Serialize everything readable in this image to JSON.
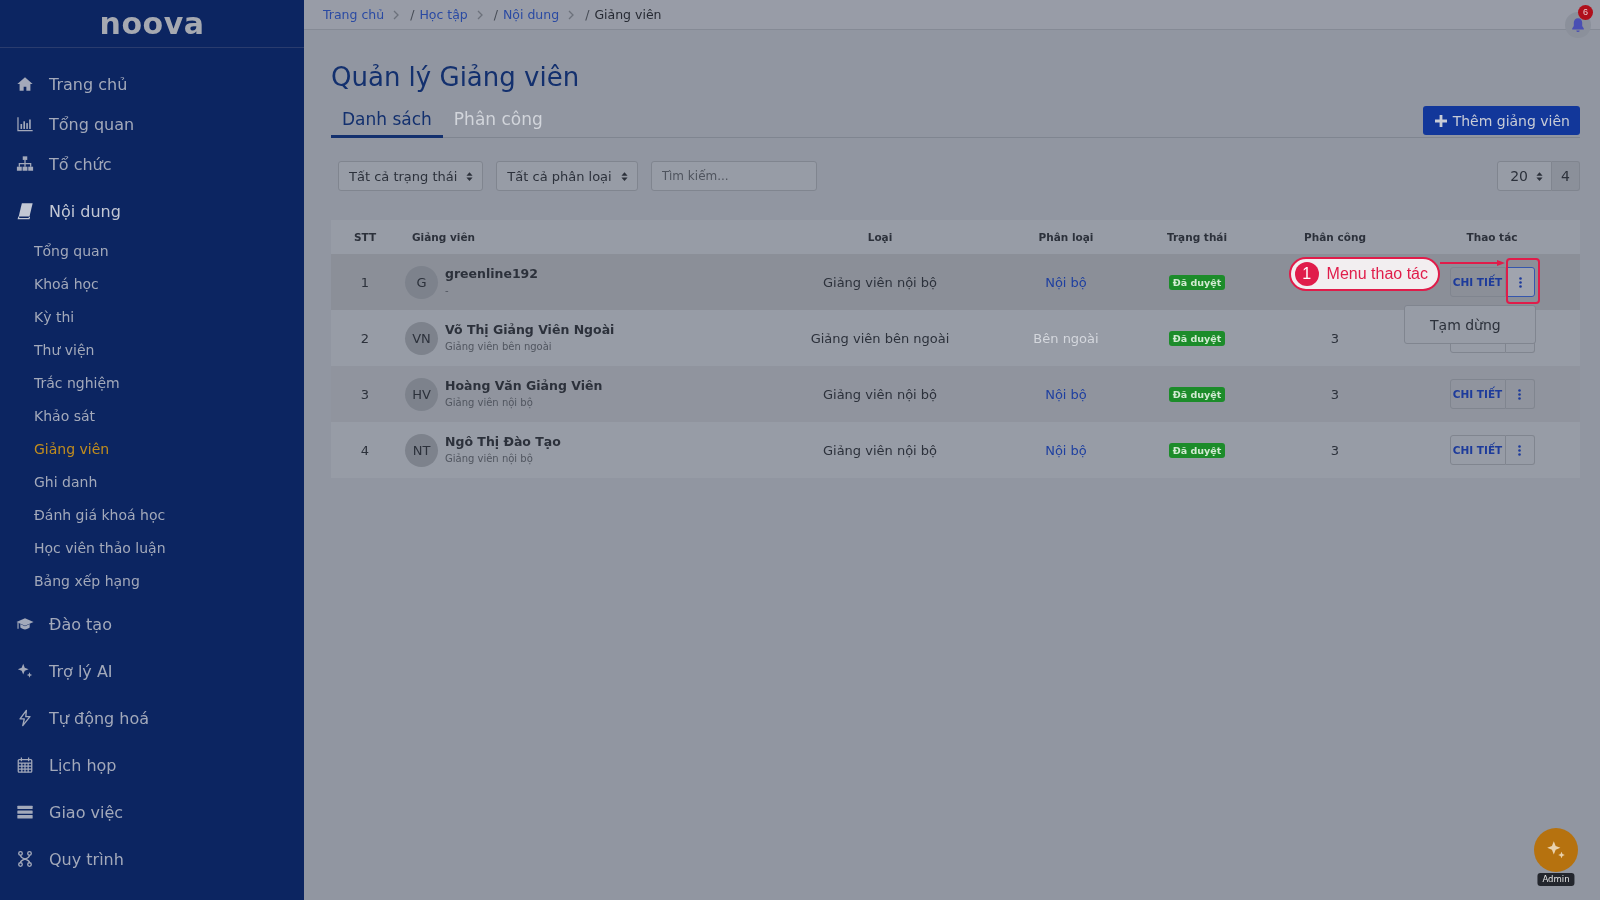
{
  "sidebar": {
    "logo": "noova",
    "items": [
      {
        "label": "Trang chủ",
        "selected": false,
        "expanded": false
      },
      {
        "label": "Tổng quan",
        "selected": false,
        "expanded": false
      },
      {
        "label": "Tổ chức",
        "selected": false,
        "expanded": false
      },
      {
        "label": "Nội dung",
        "selected": false,
        "expanded": true,
        "children": [
          {
            "label": "Tổng quan",
            "selected": false
          },
          {
            "label": "Khoá học",
            "selected": false
          },
          {
            "label": "Kỳ thi",
            "selected": false
          },
          {
            "label": "Thư viện",
            "selected": false
          },
          {
            "label": "Trắc nghiệm",
            "selected": false
          },
          {
            "label": "Khảo sát",
            "selected": false
          },
          {
            "label": "Giảng viên",
            "selected": true
          },
          {
            "label": "Ghi danh",
            "selected": false
          },
          {
            "label": "Đánh giá khoá học",
            "selected": false
          },
          {
            "label": "Học viên thảo luận",
            "selected": false
          },
          {
            "label": "Bảng xếp hạng",
            "selected": false
          }
        ]
      },
      {
        "label": "Đào tạo",
        "selected": false,
        "expanded": false
      },
      {
        "label": "Trợ lý AI",
        "selected": false,
        "expanded": false
      },
      {
        "label": "Tự động hoá",
        "selected": false,
        "expanded": false
      },
      {
        "label": "Lịch họp",
        "selected": false,
        "expanded": false
      },
      {
        "label": "Giao việc",
        "selected": false,
        "expanded": false
      },
      {
        "label": "Quy trình",
        "selected": false,
        "expanded": false
      }
    ]
  },
  "topbar": {
    "breadcrumbs": [
      {
        "label": "Trang chủ",
        "current": false
      },
      {
        "separator": "/",
        "label": "Học tập",
        "current": false
      },
      {
        "separator": "/",
        "label": "Nội dung",
        "current": false
      },
      {
        "separator": "/",
        "label": "Giảng viên",
        "current": true
      }
    ],
    "notifications": {
      "count": "6"
    }
  },
  "page": {
    "title": "Quản lý Giảng viên",
    "tabs": [
      {
        "label": "Danh sách",
        "selected": true
      },
      {
        "label": "Phân công",
        "selected": false
      }
    ],
    "add_button": {
      "label": "Thêm giảng viên"
    }
  },
  "filters": {
    "status_select": {
      "value": "Tất cả trạng thái"
    },
    "category_select": {
      "value": "Tất cả phân loại"
    },
    "search": {
      "placeholder": "Tìm kiếm..."
    },
    "page_size": {
      "value": "20"
    },
    "total": "4"
  },
  "table": {
    "columns": [
      "STT",
      "Giảng viên",
      "Loại",
      "Phân loại",
      "Trạng thái",
      "Phân công",
      "Thao tác"
    ],
    "rows": [
      {
        "index": "1",
        "initials": "G",
        "name": "greenline192",
        "subtitle": "-",
        "type": "Giảng viên nội bộ",
        "category": {
          "label": "Nội bộ",
          "kind": "internal"
        },
        "status": {
          "label": "Đã duyệt",
          "kind": "approved"
        },
        "action_label": "CHI TIẾT",
        "callout": {
          "step": "1",
          "text": "Menu thao tác"
        },
        "menu": {
          "items": [
            {
              "label": "Tạm dừng"
            }
          ]
        }
      },
      {
        "index": "2",
        "initials": "VN",
        "name": "Võ Thị Giảng Viên Ngoài",
        "subtitle": "Giảng viên bên ngoài",
        "type": "Giảng viên bên ngoài",
        "category": {
          "label": "Bên ngoài",
          "kind": "external"
        },
        "status": {
          "label": "Đã duyệt",
          "kind": "approved"
        },
        "assignments": "3"
      },
      {
        "index": "3",
        "initials": "HV",
        "name": "Hoàng Văn Giảng Viên",
        "subtitle": "Giảng viên nội bộ",
        "type": "Giảng viên nội bộ",
        "category": {
          "label": "Nội bộ",
          "kind": "internal"
        },
        "status": {
          "label": "Đã duyệt",
          "kind": "approved"
        },
        "assignments": "3",
        "action_label": "CHI TIẾT"
      },
      {
        "index": "4",
        "initials": "NT",
        "name": "Ngô Thị Đào Tạo",
        "subtitle": "Giảng viên nội bộ",
        "type": "Giảng viên nội bộ",
        "category": {
          "label": "Nội bộ",
          "kind": "internal"
        },
        "status": {
          "label": "Đã duyệt",
          "kind": "approved"
        },
        "assignments": "3",
        "action_label": "CHI TIẾT"
      }
    ]
  },
  "assistant_button": {
    "label": "Admin"
  }
}
